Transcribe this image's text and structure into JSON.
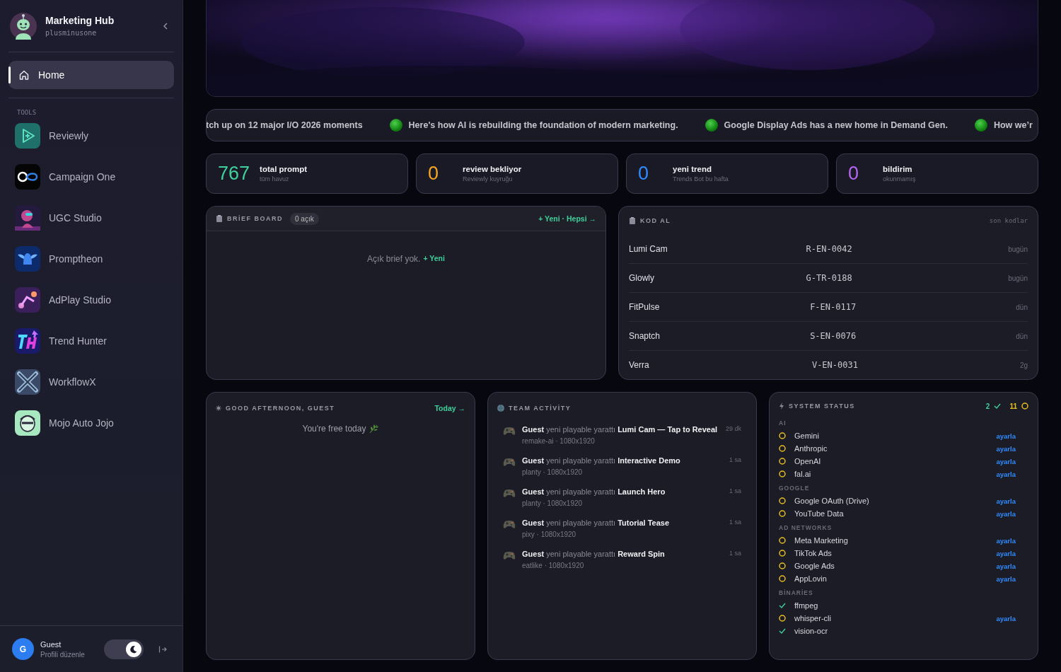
{
  "sidebar": {
    "brand": {
      "title": "Marketing Hub",
      "subtitle": "plusminusone"
    },
    "nav": [
      {
        "label": "Home",
        "selected": true
      }
    ],
    "section_label": "TOOLS",
    "tools": [
      {
        "label": "Reviewly"
      },
      {
        "label": "Campaign One"
      },
      {
        "label": "UGC Studio"
      },
      {
        "label": "Promptheon"
      },
      {
        "label": "AdPlay Studio"
      },
      {
        "label": "Trend Hunter"
      },
      {
        "label": "WorkflowX"
      },
      {
        "label": "Mojo Auto Jojo"
      }
    ],
    "user": {
      "initial": "G",
      "name": "Guest",
      "subtitle": "Profili düzenle"
    },
    "dark_mode": {
      "on": true
    }
  },
  "ticker": [
    {
      "text": "tch up on 12 major I/O 2026 moments",
      "dot": false
    },
    {
      "text": "Here's how AI is rebuilding the foundation of modern marketing.",
      "dot": true
    },
    {
      "text": "Google Display Ads has a new home in Demand Gen.",
      "dot": true
    },
    {
      "text": "How we’r",
      "dot": true
    }
  ],
  "stats": [
    {
      "count": "767",
      "title": "total prompt",
      "sub": "tüm havuz",
      "color": "#3ecf9a"
    },
    {
      "count": "0",
      "title": "review bekliyor",
      "sub": "Reviewly kuyruğu",
      "color": "#f5a524"
    },
    {
      "count": "0",
      "title": "yeni trend",
      "sub": "Trends Bot bu hafta",
      "color": "#2f8cff"
    },
    {
      "count": "0",
      "title": "bildirim",
      "sub": "okunmamış",
      "color": "#b565f0"
    }
  ],
  "brief_board": {
    "title": "BRİEF BOARD",
    "badge": "0 açık",
    "link": "+ Yeni · Hepsi →",
    "empty_text": "Açık brief yok.",
    "empty_link": "+ Yeni"
  },
  "codes": {
    "title": "KOD AL",
    "aside": "son kodlar",
    "rows": [
      {
        "name": "Lumi Cam",
        "code": "R-EN-0042",
        "when": "bugün"
      },
      {
        "name": "Glowly",
        "code": "G-TR-0188",
        "when": "bugün"
      },
      {
        "name": "FitPulse",
        "code": "F-EN-0117",
        "when": "dün"
      },
      {
        "name": "Snaptch",
        "code": "S-EN-0076",
        "when": "dün"
      },
      {
        "name": "Verra",
        "code": "V-EN-0031",
        "when": "2g"
      }
    ]
  },
  "greeting": {
    "title": "GOOD AFTERNOON, GUEST",
    "link": "Today →",
    "text": "You're free today"
  },
  "team_activity": {
    "title": "TEAM ACTİVİTY",
    "items": [
      {
        "text": "**Guest** yeni playable yarattı **Lumi Cam — Tap to Reveal**",
        "meta": "remake-ai · 1080x1920",
        "time": "29 dk"
      },
      {
        "text": "**Guest** yeni playable yarattı **Interactive Demo**",
        "meta": "planty · 1080x1920",
        "time": "1 sa"
      },
      {
        "text": "**Guest** yeni playable yarattı **Launch Hero**",
        "meta": "planty · 1080x1920",
        "time": "1 sa"
      },
      {
        "text": "**Guest** yeni playable yarattı **Tutorial Tease**",
        "meta": "pixy · 1080x1920",
        "time": "1 sa"
      },
      {
        "text": "**Guest** yeni playable yarattı **Reward Spin**",
        "meta": "eatlike · 1080x1920",
        "time": "1 sa"
      }
    ]
  },
  "system_status": {
    "title": "SYSTEM STATUS",
    "ok_count": "2",
    "pending_count": "11",
    "groups": [
      {
        "label": "AI",
        "items": [
          {
            "name": "Gemini",
            "kind": "pending",
            "action": "ayarla"
          },
          {
            "name": "Anthropic",
            "kind": "pending",
            "action": "ayarla"
          },
          {
            "name": "OpenAI",
            "kind": "pending",
            "action": "ayarla"
          },
          {
            "name": "fal.ai",
            "kind": "pending",
            "action": "ayarla"
          }
        ]
      },
      {
        "label": "GOOGLE",
        "items": [
          {
            "name": "Google OAuth (Drive)",
            "kind": "pending",
            "action": "ayarla"
          },
          {
            "name": "YouTube Data",
            "kind": "pending",
            "action": "ayarla"
          }
        ]
      },
      {
        "label": "AD NETWORKS",
        "items": [
          {
            "name": "Meta Marketing",
            "kind": "pending",
            "action": "ayarla"
          },
          {
            "name": "TikTok Ads",
            "kind": "pending",
            "action": "ayarla"
          },
          {
            "name": "Google Ads",
            "kind": "pending",
            "action": "ayarla"
          },
          {
            "name": "AppLovin",
            "kind": "pending",
            "action": "ayarla"
          }
        ]
      },
      {
        "label": "BİNARİES",
        "items": [
          {
            "name": "ffmpeg",
            "kind": "ok"
          },
          {
            "name": "whisper-cli",
            "kind": "pending",
            "action": "ayarla"
          },
          {
            "name": "vision-ocr",
            "kind": "ok"
          }
        ]
      }
    ]
  }
}
